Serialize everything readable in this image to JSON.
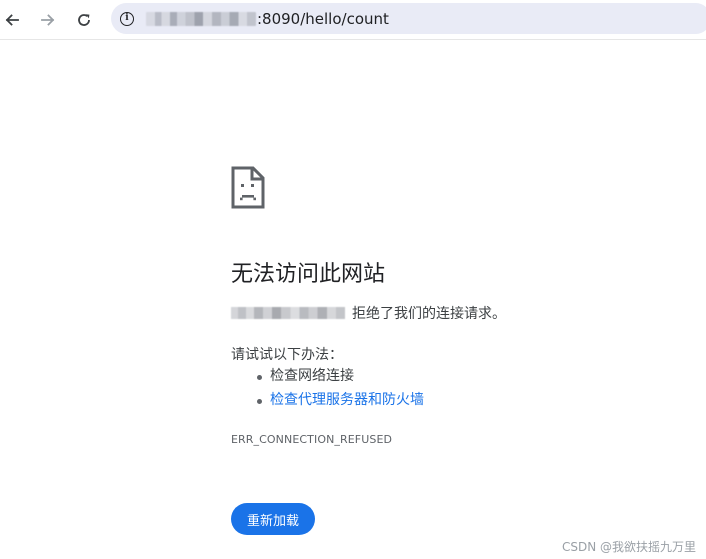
{
  "browser": {
    "back_icon": "arrow-left-icon",
    "forward_icon": "arrow-right-icon",
    "reload_icon": "reload-icon",
    "info_icon": "info-icon",
    "url_visible": ":8090/hello/count"
  },
  "error_page": {
    "icon": "sad-document-icon",
    "title": "无法访问此网站",
    "refused_message": "拒绝了我们的连接请求。",
    "suggestions_heading": "请试试以下办法：",
    "suggestions": [
      {
        "label": "检查网络连接",
        "is_link": false
      },
      {
        "label": "检查代理服务器和防火墙",
        "is_link": true
      }
    ],
    "error_code": "ERR_CONNECTION_REFUSED",
    "reload_button_label": "重新加载"
  },
  "watermark": "CSDN @我欲扶摇九万里",
  "colors": {
    "primary_blue": "#1a73e8",
    "omnibox_bg": "#e9ebf6",
    "text_primary": "#202124",
    "text_secondary": "#3c4043"
  }
}
